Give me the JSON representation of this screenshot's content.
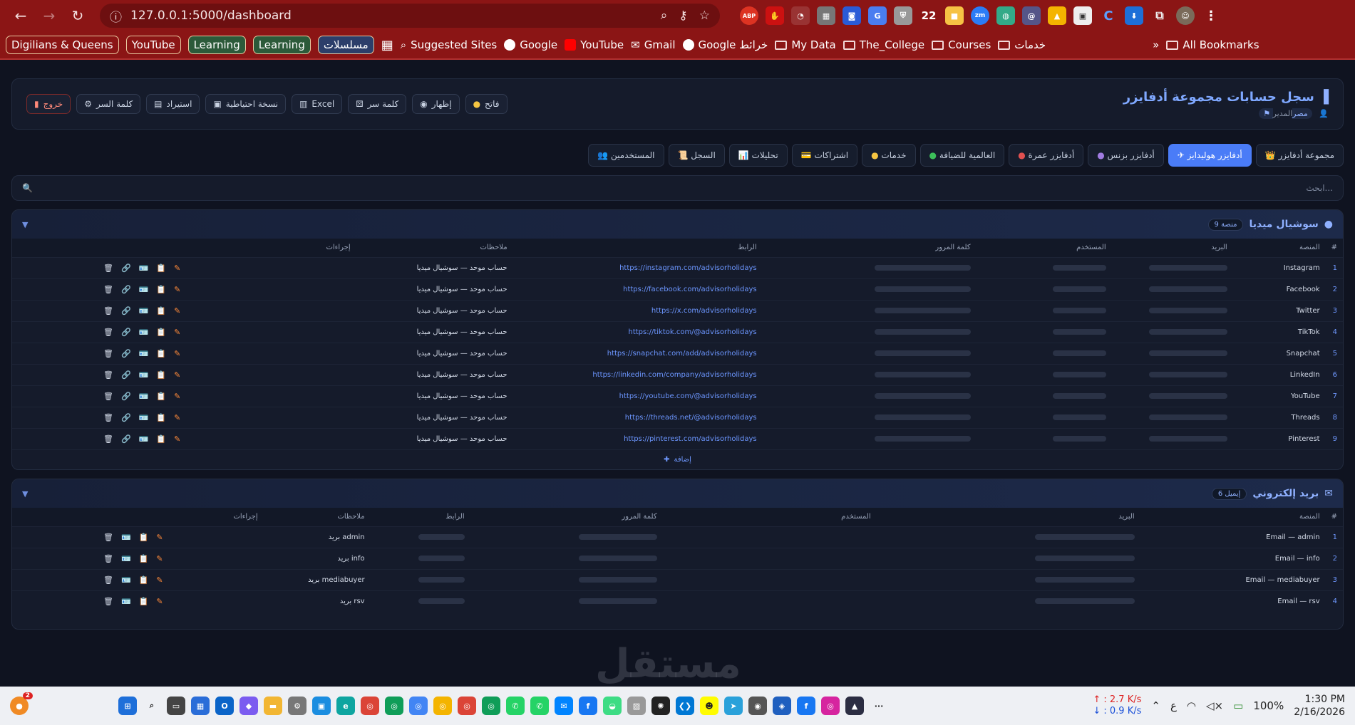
{
  "browser": {
    "url": "127.0.0.1:5000/dashboard",
    "ext_badge": "22",
    "ext_abp": "ABP",
    "ext_zm": "zm",
    "ext_c": "C"
  },
  "bookmarks": {
    "pills": [
      "Digilians & Queens",
      "YouTube",
      "Learning",
      "Learning",
      "مسلسلات"
    ],
    "items": [
      "Suggested Sites",
      "Google",
      "YouTube",
      "Gmail",
      "Google خرائط",
      "My Data",
      "The_College",
      "Courses",
      "خدمات"
    ],
    "all": "All Bookmarks"
  },
  "header": {
    "title": "سجل حسابات مجموعة أدفايزر",
    "role": "المدير",
    "country": "مصر",
    "buttons": [
      "فاتح",
      "إظهار",
      "كلمة سر",
      "Excel",
      "نسخة احتياطية",
      "استيراد",
      "كلمة السر",
      "خروج"
    ]
  },
  "tabs": [
    "مجموعة أدفايزر",
    "أدفايزر هوليدايز",
    "أدفايزر بزنس",
    "أدفايزر عمرة",
    "العالمية للضيافة",
    "خدمات",
    "اشتراكات",
    "تحليلات",
    "السجل",
    "المستخدمين"
  ],
  "search": {
    "placeholder": "ابحث..."
  },
  "social": {
    "title": "سوشيال ميديا",
    "count": "9 منصة",
    "headers": [
      "#",
      "المنصة",
      "البريد",
      "المستخدم",
      "كلمة المرور",
      "الرابط",
      "ملاحظات",
      "إجراءات"
    ],
    "rows": [
      {
        "n": "1",
        "p": "Instagram",
        "u": "https://instagram.com/advisorholidays",
        "note": "حساب موحد — سوشيال ميديا"
      },
      {
        "n": "2",
        "p": "Facebook",
        "u": "https://facebook.com/advisorholidays",
        "note": "حساب موحد — سوشيال ميديا"
      },
      {
        "n": "3",
        "p": "Twitter",
        "u": "https://x.com/advisorholidays",
        "note": "حساب موحد — سوشيال ميديا"
      },
      {
        "n": "4",
        "p": "TikTok",
        "u": "https://tiktok.com/@advisorholidays",
        "note": "حساب موحد — سوشيال ميديا"
      },
      {
        "n": "5",
        "p": "Snapchat",
        "u": "https://snapchat.com/add/advisorholidays",
        "note": "حساب موحد — سوشيال ميديا"
      },
      {
        "n": "6",
        "p": "LinkedIn",
        "u": "https://linkedin.com/company/advisorholidays",
        "note": "حساب موحد — سوشيال ميديا"
      },
      {
        "n": "7",
        "p": "YouTube",
        "u": "https://youtube.com/@advisorholidays",
        "note": "حساب موحد — سوشيال ميديا"
      },
      {
        "n": "8",
        "p": "Threads",
        "u": "https://threads.net/@advisorholidays",
        "note": "حساب موحد — سوشيال ميديا"
      },
      {
        "n": "9",
        "p": "Pinterest",
        "u": "https://pinterest.com/advisorholidays",
        "note": "حساب موحد — سوشيال ميديا"
      }
    ],
    "add": "إضافة"
  },
  "email": {
    "title": "بريد إلكتروني",
    "count": "6 إيميل",
    "headers": [
      "#",
      "المنصة",
      "البريد",
      "المستخدم",
      "كلمة المرور",
      "الرابط",
      "ملاحظات",
      "إجراءات"
    ],
    "rows": [
      {
        "n": "1",
        "p": "Email — admin",
        "note": "admin بريد"
      },
      {
        "n": "2",
        "p": "Email — info",
        "note": "info بريد"
      },
      {
        "n": "3",
        "p": "Email — mediabuyer",
        "note": "mediabuyer بريد"
      },
      {
        "n": "4",
        "p": "Email — rsv",
        "note": "rsv بريد"
      }
    ]
  },
  "taskbar": {
    "up": "↑ : 2.7 K/s",
    "down": "↓ : 0.9 K/s",
    "battery": "100%",
    "time": "1:30 PM",
    "date": "2/16/2026",
    "lang": "ع",
    "badge": "2"
  },
  "watermark": "مستقل"
}
